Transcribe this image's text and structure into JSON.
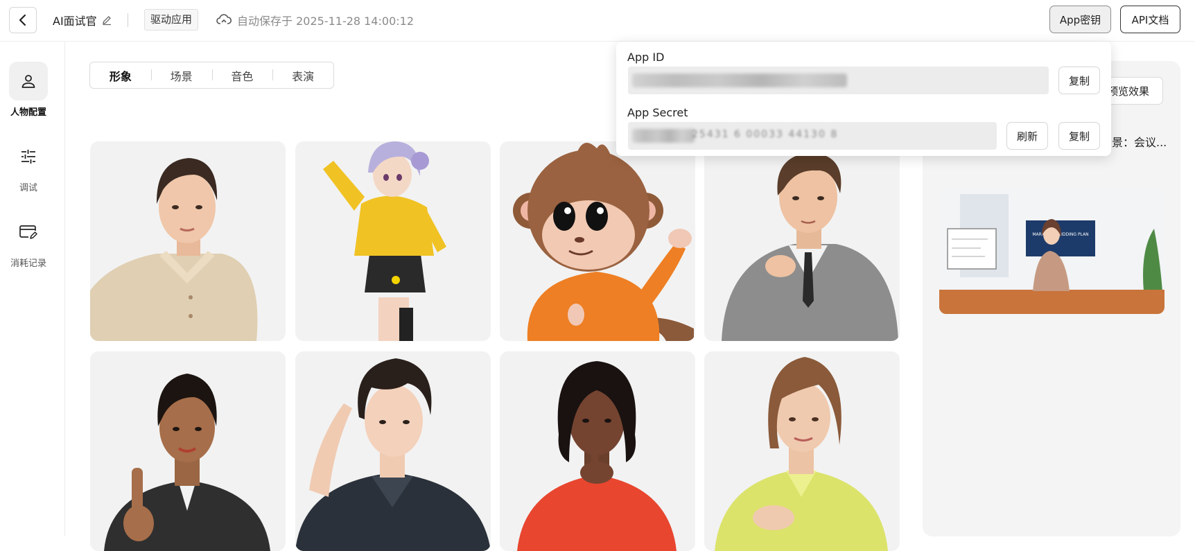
{
  "header": {
    "app_name": "AI面试官",
    "tag": "驱动应用",
    "autosave": "自动保存于 2025-11-28 14:00:12",
    "app_key_btn": "App密钥",
    "api_doc_btn": "API文档"
  },
  "sidebar": {
    "items": [
      {
        "label": "人物配置",
        "icon": "person-icon",
        "active": true
      },
      {
        "label": "调试",
        "icon": "sliders-icon",
        "active": false
      },
      {
        "label": "消耗记录",
        "icon": "card-edit-icon",
        "active": false
      }
    ]
  },
  "tabs": [
    {
      "label": "形象",
      "active": true
    },
    {
      "label": "场景",
      "active": false
    },
    {
      "label": "音色",
      "active": false
    },
    {
      "label": "表演",
      "active": false
    }
  ],
  "avatars": [
    {
      "name": "woman-beige-shirt"
    },
    {
      "name": "anime-girl-yellow-jacket"
    },
    {
      "name": "cartoon-monkey-orange-shirt"
    },
    {
      "name": "man-grey-suit"
    },
    {
      "name": "woman-black-jacket"
    },
    {
      "name": "young-man-dark-shirt"
    },
    {
      "name": "woman-red-top"
    },
    {
      "name": "woman-yellow-jacket"
    }
  ],
  "right_panel": {
    "preview_btn": "预览效果",
    "scene_text": "景：会议...",
    "screen_text": "MARKETING BIDDING PLAN"
  },
  "app_secret_popover": {
    "app_id_label": "App ID",
    "app_secret_label": "App Secret",
    "secret_visible_fragment": "25431 6 00033 44130 8",
    "refresh_btn": "刷新",
    "copy_btn": "复制"
  }
}
